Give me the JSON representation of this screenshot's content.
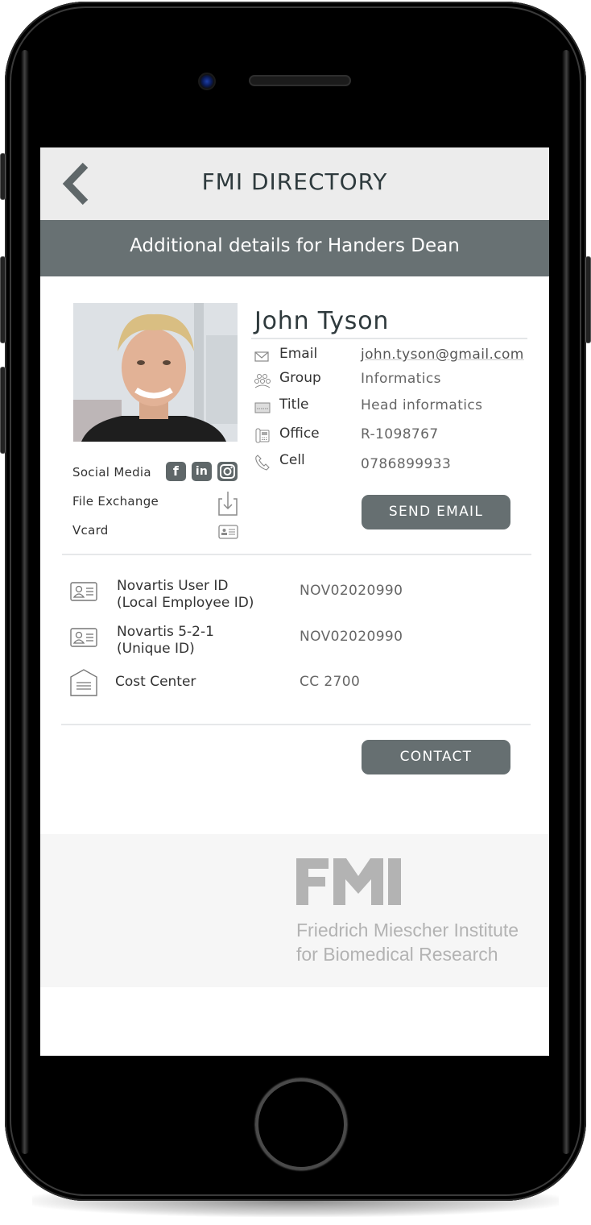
{
  "app": {
    "title": "FMI DIRECTORY",
    "back_icon": "chevron-left-icon"
  },
  "subheader": {
    "text": "Additional details for Handers Dean"
  },
  "profile": {
    "name": "John Tyson",
    "photo_alt": "Profile photo of John Tyson",
    "fields": [
      {
        "icon": "envelope-icon",
        "label": "Email",
        "value": "john.tyson@gmail.com"
      },
      {
        "icon": "group-icon",
        "label": "Group",
        "value": "Informatics"
      },
      {
        "icon": "keyboard-icon",
        "label": "Title",
        "value": "Head informatics"
      },
      {
        "icon": "desk-phone-icon",
        "label": "Office",
        "value": "R-1098767"
      },
      {
        "icon": "phone-icon",
        "label": "Cell",
        "value": "0786899933"
      }
    ],
    "send_email_label": "SEND EMAIL"
  },
  "side_links": {
    "social_media_label": "Social Media",
    "social": [
      {
        "icon": "facebook-icon",
        "glyph": "f"
      },
      {
        "icon": "linkedin-icon",
        "glyph": "in"
      },
      {
        "icon": "instagram-icon",
        "glyph": ""
      }
    ],
    "file_exchange_label": "File Exchange",
    "vcard_label": "Vcard"
  },
  "ids": [
    {
      "icon": "id-card-icon",
      "label_line1": "Novartis User ID",
      "label_line2": "(Local Employee ID)",
      "value": "NOV02020990"
    },
    {
      "icon": "id-card-icon",
      "label_line1": "Novartis 5-2-1",
      "label_line2": "(Unique ID)",
      "value": "NOV02020990"
    },
    {
      "icon": "cost-center-icon",
      "label_line1": "Cost Center",
      "label_line2": "",
      "value": "CC 2700"
    }
  ],
  "contact_label": "CONTACT",
  "footer": {
    "logo_text": "FMI",
    "institute_line1": "Friedrich Miescher Institute",
    "institute_line2": "for Biomedical Research"
  },
  "colors": {
    "bar_gray": "#687173",
    "button_gray": "#666f71",
    "topbar_bg": "#ececec",
    "title_text": "#2e3a3d",
    "logo_gray": "#b3b3b3"
  }
}
